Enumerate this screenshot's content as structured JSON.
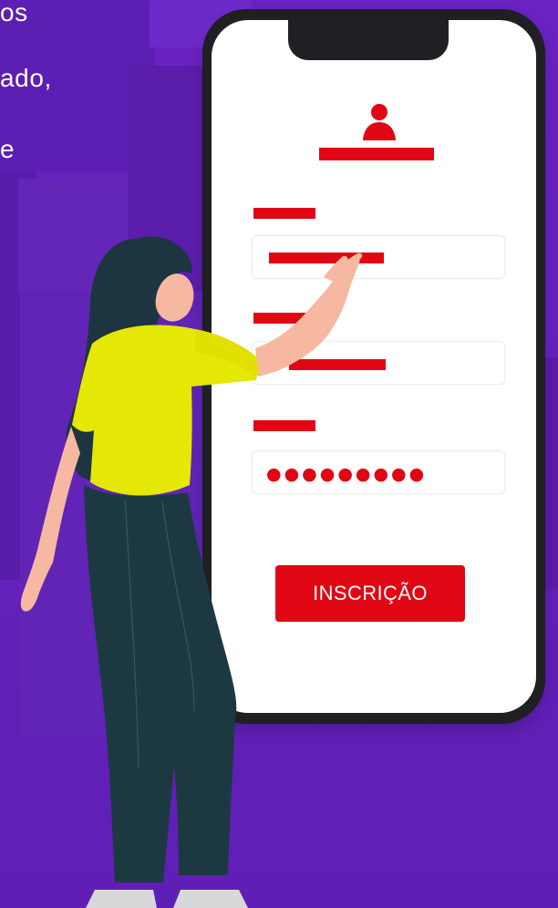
{
  "headline": {
    "line1": "os",
    "line2": "ado,",
    "line3": "e"
  },
  "form": {
    "password_mask": "●●●●●●●●●",
    "submit_label": "INSCRIÇÃO"
  },
  "theme": {
    "accent": "#e10613",
    "background": "#6a22c2",
    "phone_frame": "#1f1f24"
  },
  "icons": {
    "user": "user-icon"
  }
}
